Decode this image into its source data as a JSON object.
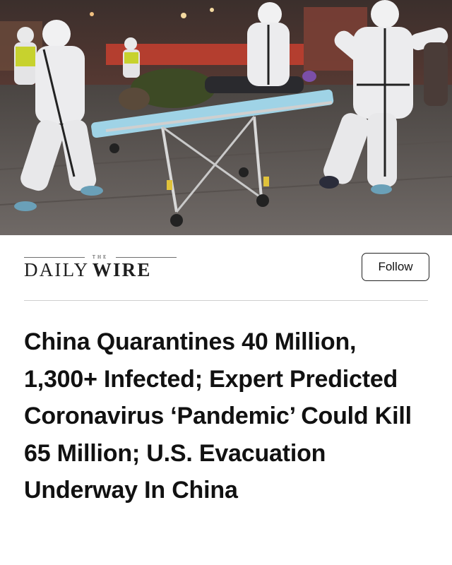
{
  "hero": {
    "image_icon": "photo-of-medical-workers-in-hazmat-suits-wheeling-stretcher"
  },
  "publisher": {
    "logo_small": "THE",
    "logo_word_1": "DAILY",
    "logo_word_2": "WIRE",
    "follow_label": "Follow"
  },
  "article": {
    "headline": "China Quarantines 40 Million, 1,300+ Infected; Expert Predicted Coronavirus ‘Pandemic’ Could Kill 65 Million; U.S. Evacuation Underway In China"
  },
  "colors": {
    "text": "#111111",
    "divider": "#cfcfcf",
    "button_border": "#222222"
  }
}
